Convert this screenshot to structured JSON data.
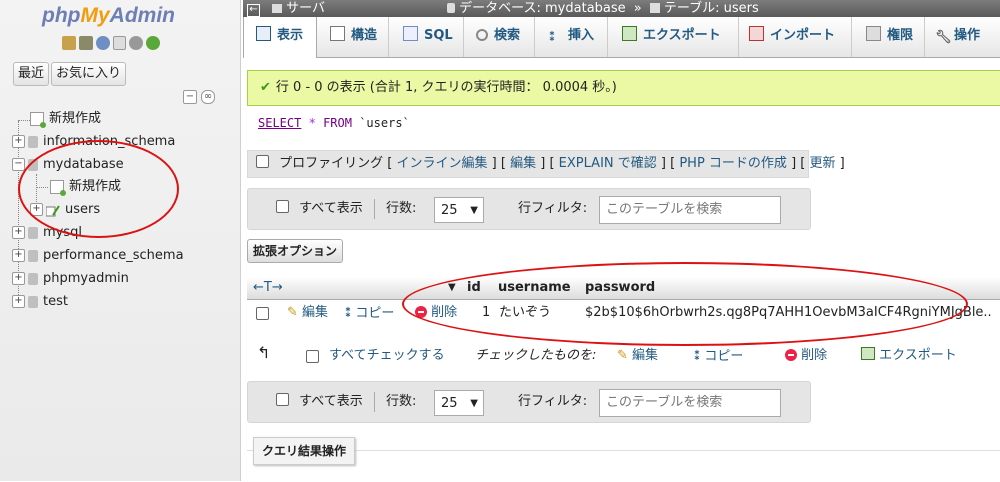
{
  "sidebar": {
    "logo": {
      "php": "php",
      "my": "My",
      "admin": "Admin"
    },
    "recent_label": "最近",
    "favorites_label": "お気に入り",
    "tree": [
      {
        "label": "新規作成"
      },
      {
        "label": "information_schema"
      },
      {
        "label": "mydatabase"
      },
      {
        "label": "新規作成"
      },
      {
        "label": "users"
      },
      {
        "label": "mysql"
      },
      {
        "label": "performance_schema"
      },
      {
        "label": "phpmyadmin"
      },
      {
        "label": "test"
      }
    ]
  },
  "breadcrumb": {
    "server": "サーバ",
    "database": "データベース: mydatabase",
    "separator": "»",
    "table": "テーブル: users"
  },
  "tabs": [
    {
      "label": "表示",
      "icon": "browse-icon"
    },
    {
      "label": "構造",
      "icon": "structure-icon"
    },
    {
      "label": "SQL",
      "icon": "sql-icon"
    },
    {
      "label": "検索",
      "icon": "search-icon"
    },
    {
      "label": "挿入",
      "icon": "insert-icon"
    },
    {
      "label": "エクスポート",
      "icon": "export-icon"
    },
    {
      "label": "インポート",
      "icon": "import-icon"
    },
    {
      "label": "権限",
      "icon": "privileges-icon"
    },
    {
      "label": "操作",
      "icon": "wrench-icon"
    }
  ],
  "message": "行 0 - 0 の表示 (合計 1, クエリの実行時間： 0.0004 秒。)",
  "sql": {
    "select": "SELECT",
    "star": "*",
    "from": "FROM",
    "table": "`users`"
  },
  "profiling": {
    "label": "プロファイリング",
    "open": "[",
    "sep": "] [",
    "close": "]",
    "links": [
      "インライン編集",
      "編集",
      "EXPLAIN で確認",
      "PHP コードの作成",
      "更新"
    ]
  },
  "navigation": {
    "show_all": "すべて表示",
    "rows_label": "行数:",
    "rows_value": "25",
    "filter_label": "行フィルタ:",
    "filter_placeholder": "このテーブルを検索"
  },
  "extra_options": "拡張オプション",
  "table": {
    "columns": [
      "id",
      "username",
      "password"
    ],
    "rows": [
      {
        "edit": "編集",
        "copy": "コピー",
        "delete": "削除",
        "id": "1",
        "username": "たいぞう",
        "password": "$2b$10$6hOrbwrh2s.qg8Pq7AHH1OevbM3aICF4RgniYMJgBle..."
      }
    ]
  },
  "bulk": {
    "check_all": "すべてチェックする",
    "with_selected": "チェックしたものを:",
    "edit": "編集",
    "copy": "コピー",
    "delete": "削除",
    "export": "エクスポート"
  },
  "query_results_ops": "クエリ結果操作",
  "colors": {
    "accent": "#235a81",
    "success_bg": "#ebf8a4",
    "annotation": "#dd1111"
  }
}
